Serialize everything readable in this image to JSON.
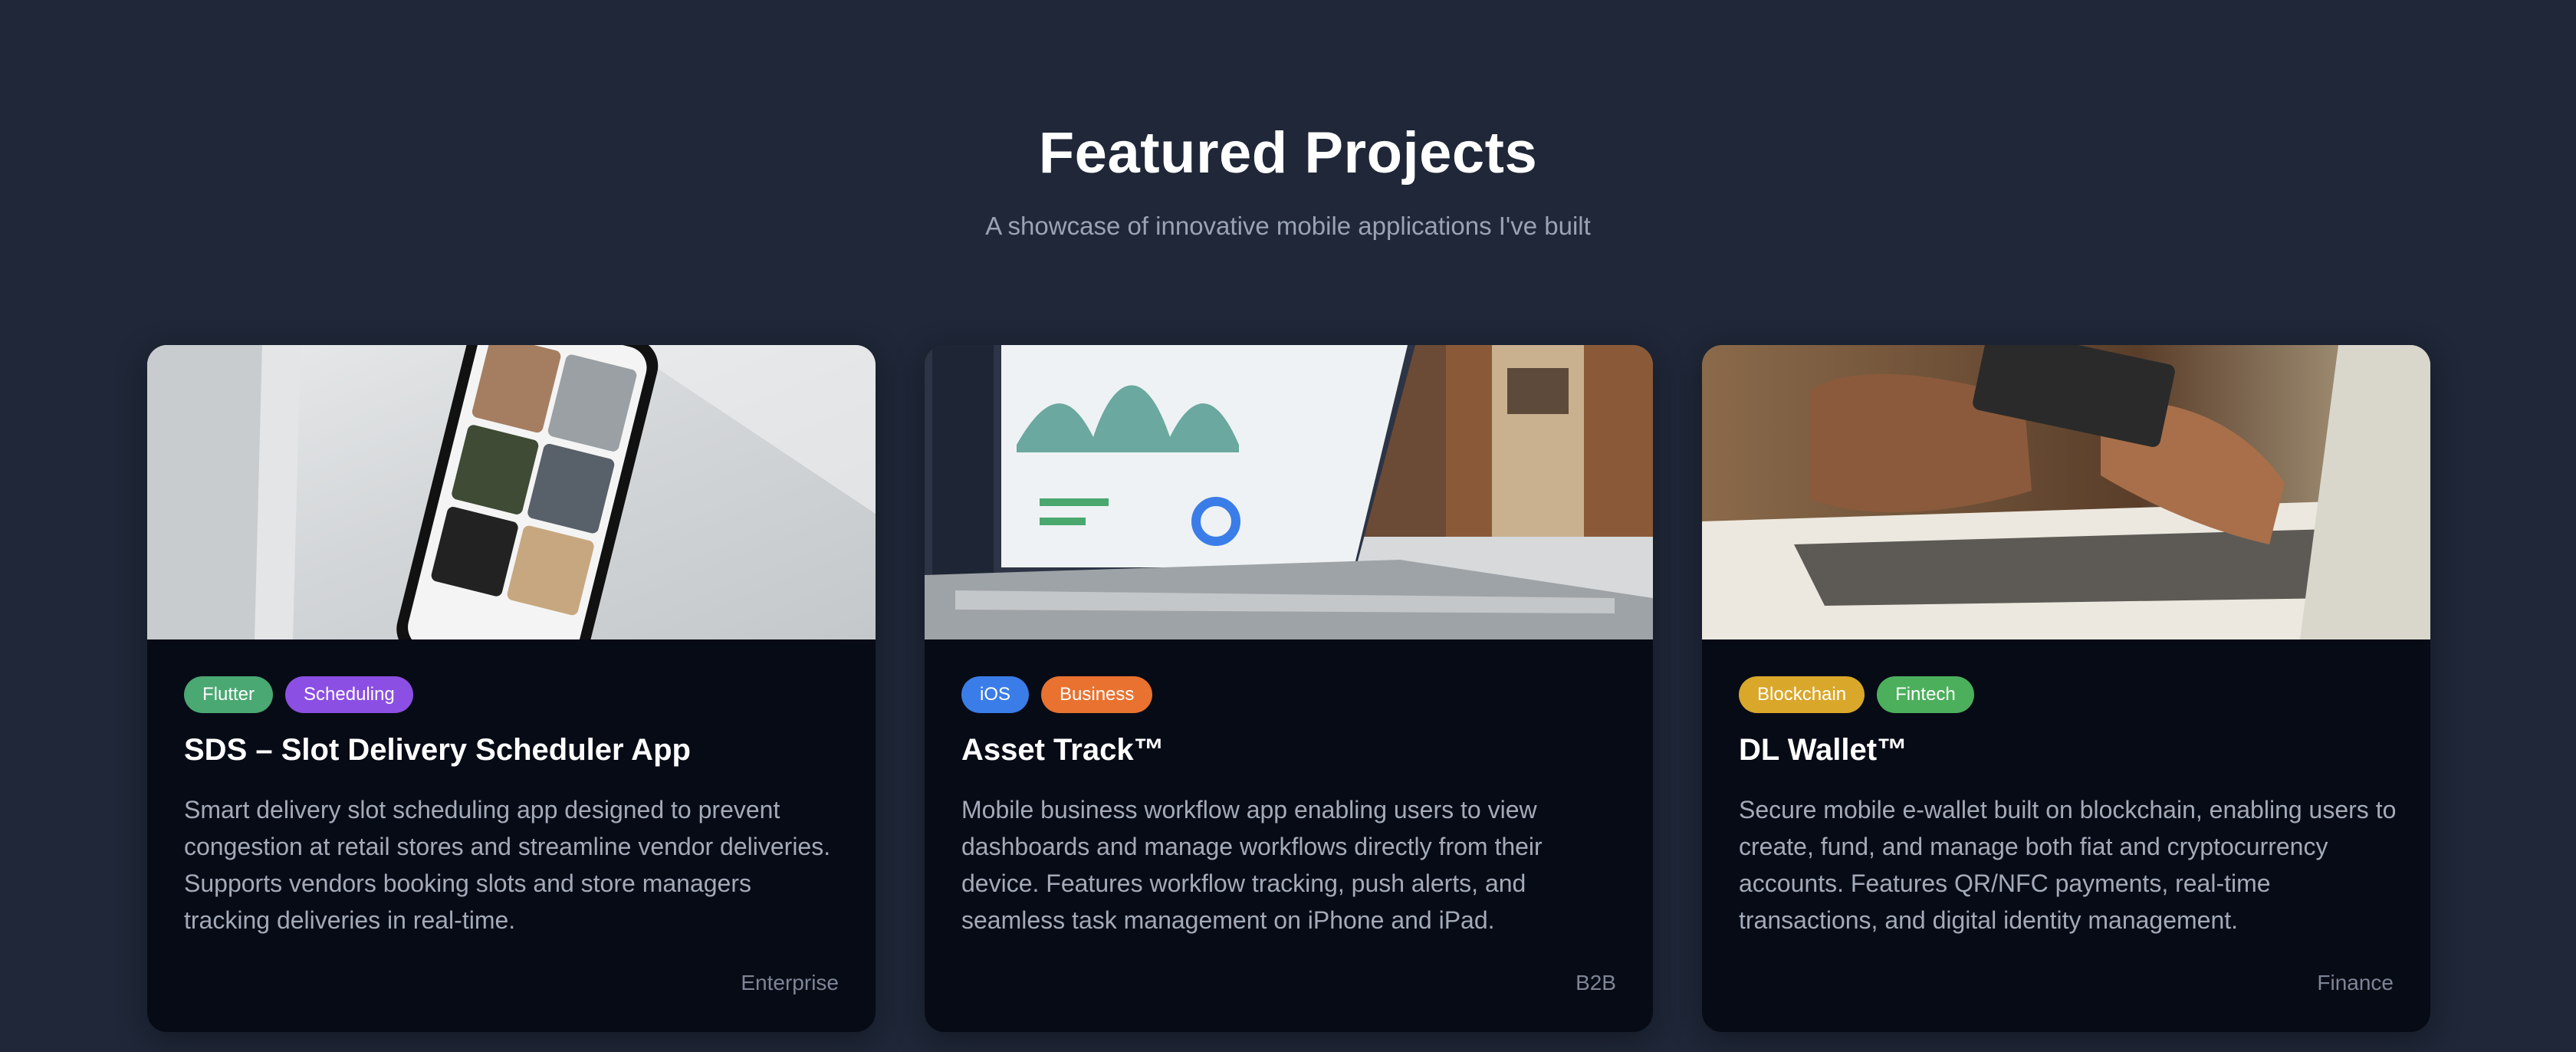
{
  "header": {
    "title": "Featured Projects",
    "subtitle": "A showcase of innovative mobile applications I've built"
  },
  "projects": [
    {
      "tags": [
        {
          "label": "Flutter",
          "color": "#4aa872"
        },
        {
          "label": "Scheduling",
          "color": "#8c4fe3"
        }
      ],
      "title": "SDS – Slot Delivery Scheduler App",
      "description": "Smart delivery slot scheduling app designed to prevent congestion at retail stores and streamline vendor deliveries. Supports vendors booking slots and store managers tracking deliveries in real-time.",
      "category": "Enterprise",
      "image": "phone-on-desk"
    },
    {
      "tags": [
        {
          "label": "iOS",
          "color": "#3b7de8"
        },
        {
          "label": "Business",
          "color": "#e97230"
        }
      ],
      "title": "Asset Track™",
      "description": "Mobile business workflow app enabling users to view dashboards and manage workflows directly from their device. Features workflow tracking, push alerts, and seamless task management on iPhone and iPad.",
      "category": "B2B",
      "image": "laptop-dashboard"
    },
    {
      "tags": [
        {
          "label": "Blockchain",
          "color": "#d9a72a"
        },
        {
          "label": "Fintech",
          "color": "#4caf5c"
        }
      ],
      "title": "DL Wallet™",
      "description": "Secure mobile e-wallet built on blockchain, enabling users to create, fund, and manage both fiat and cryptocurrency accounts. Features QR/NFC payments, real-time transactions, and digital identity management.",
      "category": "Finance",
      "image": "hands-card-laptop"
    }
  ]
}
